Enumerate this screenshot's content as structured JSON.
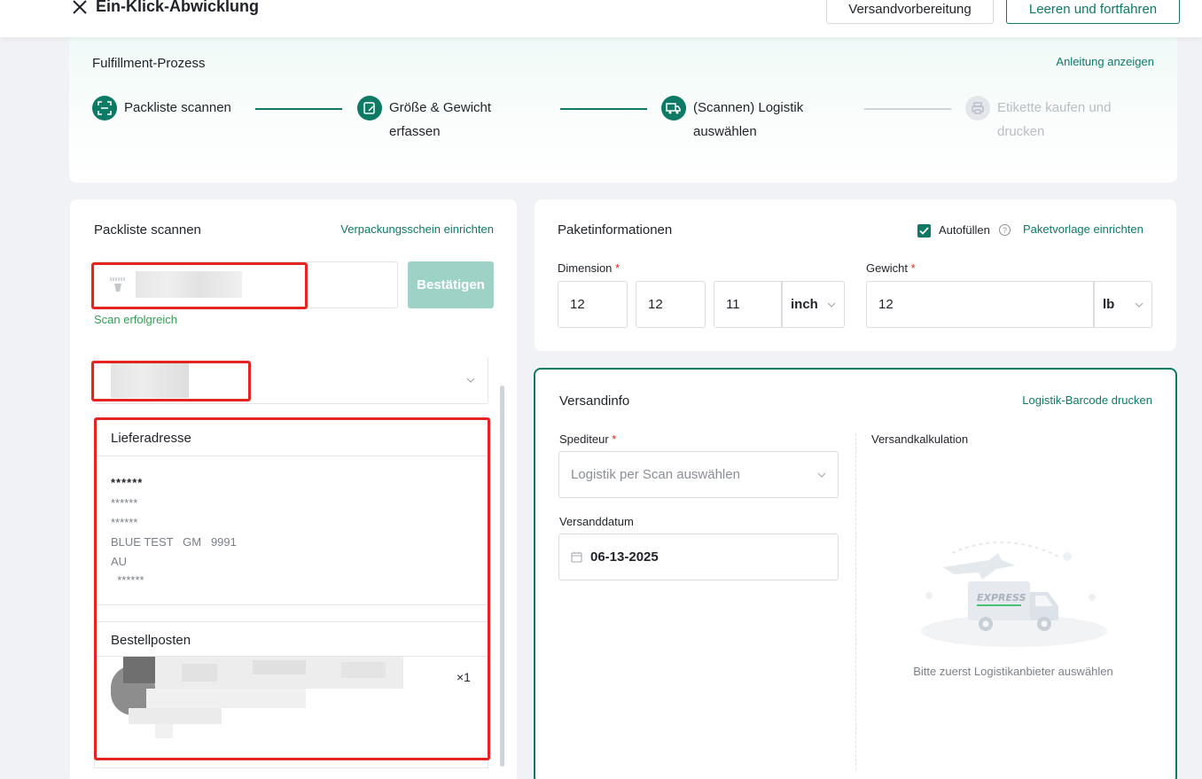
{
  "header": {
    "title": "Ein-Klick-Abwicklung",
    "btn_prep": "Versandvorbereitung",
    "btn_clear": "Leeren und fortfahren"
  },
  "process": {
    "title": "Fulfillment-Prozess",
    "guide": "Anleitung anzeigen",
    "steps": [
      {
        "line1": "Packliste scannen",
        "line2": "",
        "state": "done"
      },
      {
        "line1": "Größe & Gewicht",
        "line2": "erfassen",
        "state": "done"
      },
      {
        "line1": "(Scannen) Logistik",
        "line2": "auswählen",
        "state": "active"
      },
      {
        "line1": "Etikette kaufen und",
        "line2": "drucken",
        "state": "pending"
      }
    ]
  },
  "scan": {
    "title": "Packliste scannen",
    "setup_link": "Verpackungsschein einrichten",
    "confirm": "Bestätigen",
    "status": "Scan erfolgreich"
  },
  "address": {
    "title": "Lieferadresse",
    "name": "******",
    "lines": [
      "******",
      "******",
      "BLUE TEST   GM   9991",
      "AU",
      "  ******"
    ]
  },
  "items": {
    "title": "Bestellposten",
    "qty": "×1"
  },
  "package": {
    "title": "Paketinformationen",
    "autofill": "Autofüllen",
    "template_link": "Paketvorlage einrichten",
    "dimension_label": "Dimension",
    "dim1": "12",
    "dim2": "12",
    "dim3": "11",
    "dim_unit": "inch",
    "weight_label": "Gewicht",
    "weight": "12",
    "weight_unit": "lb"
  },
  "shipping": {
    "title": "Versandinfo",
    "barcode_link": "Logistik-Barcode drucken",
    "carrier_label": "Spediteur",
    "carrier_placeholder": "Logistik per Scan auswählen",
    "date_label": "Versanddatum",
    "date": "06-13-2025",
    "calc_label": "Versandkalkulation",
    "express": "EXPRESS",
    "empty_text": "Bitte zuerst Logistikanbieter auswählen"
  },
  "colors": {
    "accent": "#0d7a66",
    "annotation": "#e4241e",
    "success": "#2ea052"
  }
}
